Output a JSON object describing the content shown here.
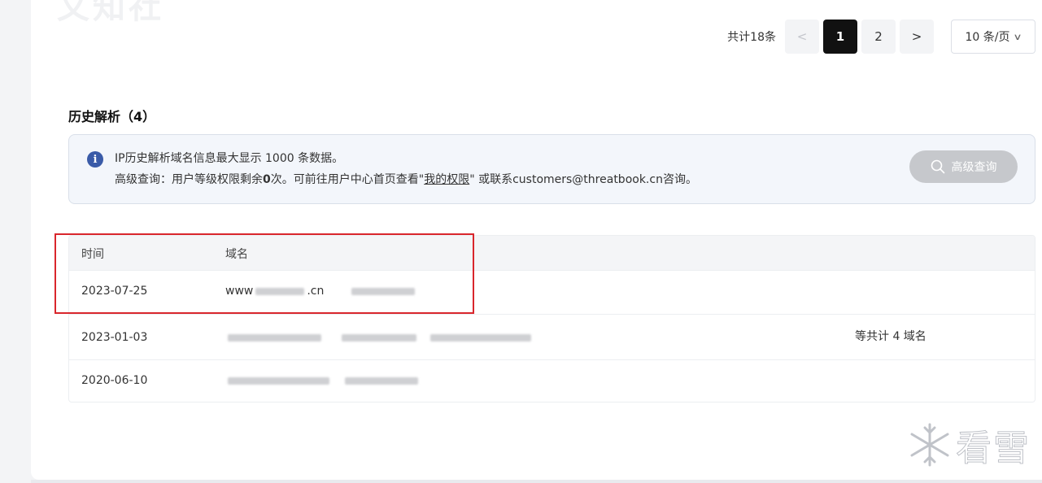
{
  "watermark_top": "文知社",
  "pagination": {
    "total": "共计18条",
    "prev": "<",
    "pages": [
      "1",
      "2"
    ],
    "next": ">",
    "page_size": "10 条/页"
  },
  "section": {
    "title": "历史解析（4）"
  },
  "notice": {
    "icon": "info-icon",
    "line1": "IP历史解析域名信息最大显示 1000 条数据。",
    "line2_prefix": "高级查询：用户等级权限剩余",
    "line2_count": "0",
    "line2_mid": "次。可前往用户中心首页查看\"",
    "line2_link": "我的权限",
    "line2_suffix": "\" 或联系customers@threatbook.cn咨询。",
    "button_label": "高级查询"
  },
  "table": {
    "headers": [
      "时间",
      "域名"
    ],
    "rows": [
      {
        "time": "2023-07-25",
        "domain_prefix": "www",
        "domain_suffix": ".cn",
        "extra": ""
      },
      {
        "time": "2023-01-03",
        "domain_prefix": "",
        "domain_suffix": "",
        "extra": "等共计 4 域名"
      },
      {
        "time": "2020-06-10",
        "domain_prefix": "",
        "domain_suffix": "",
        "extra": ""
      }
    ]
  },
  "watermark_br": "看雪",
  "colors": {
    "highlight": "#d9262c",
    "active_page": "#111111",
    "info_icon": "#3a5ba8"
  }
}
